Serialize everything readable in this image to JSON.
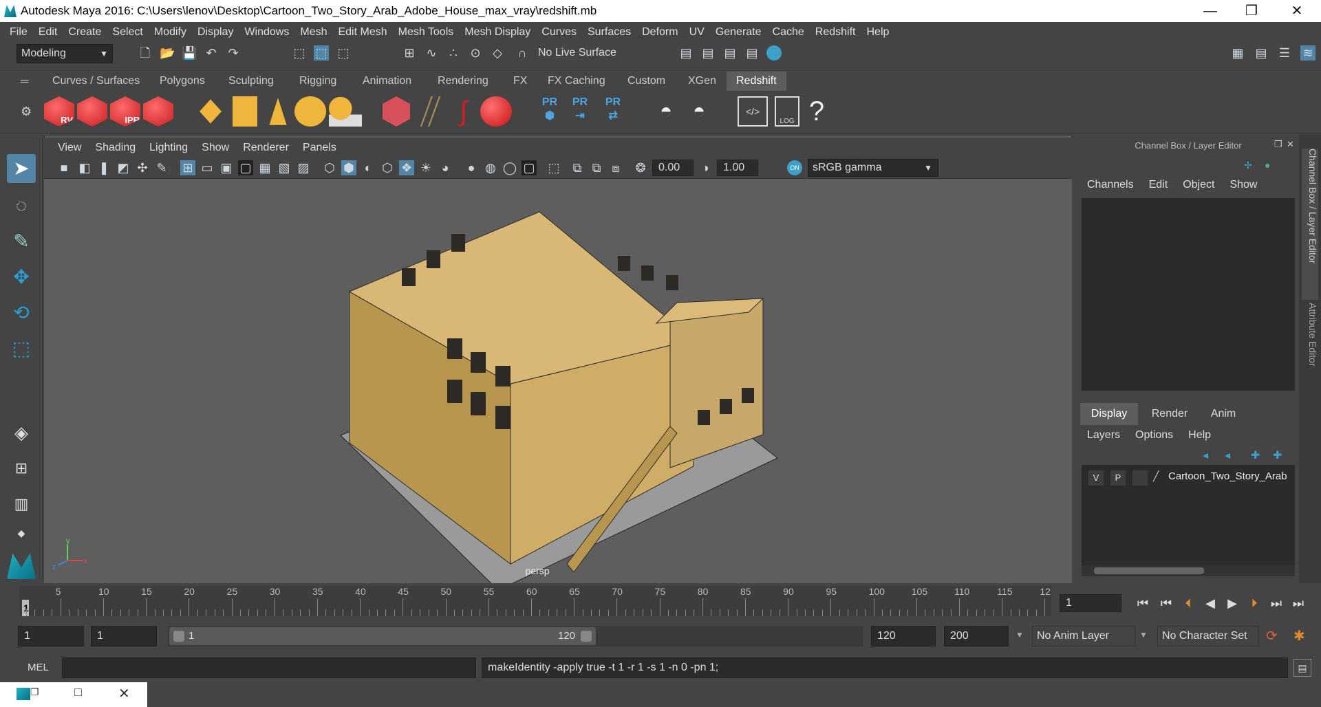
{
  "window": {
    "title": "Autodesk Maya 2016: C:\\Users\\lenov\\Desktop\\Cartoon_Two_Story_Arab_Adobe_House_max_vray\\redshift.mb",
    "minimize": "—",
    "maximize": "❐",
    "close": "✕"
  },
  "menubar": [
    "File",
    "Edit",
    "Create",
    "Select",
    "Modify",
    "Display",
    "Windows",
    "Mesh",
    "Edit Mesh",
    "Mesh Tools",
    "Mesh Display",
    "Curves",
    "Surfaces",
    "Deform",
    "UV",
    "Generate",
    "Cache",
    "Redshift",
    "Help"
  ],
  "statusline": {
    "mode": "Modeling",
    "live_surface": "No Live Surface"
  },
  "shelf_tabs": [
    "Curves / Surfaces",
    "Polygons",
    "Sculpting",
    "Rigging",
    "Animation",
    "Rendering",
    "FX",
    "FX Caching",
    "Custom",
    "XGen",
    "Redshift"
  ],
  "shelf_active": "Redshift",
  "shelf_icons": {
    "rv": "RV",
    "ipr": "IPR",
    "pr": "PR",
    "log": "LOG",
    "help": "?"
  },
  "viewport": {
    "menus": [
      "View",
      "Shading",
      "Lighting",
      "Show",
      "Renderer",
      "Panels"
    ],
    "exposure": "0.00",
    "gamma": "1.00",
    "color_space": "sRGB gamma",
    "camera_label": "persp",
    "axis": {
      "x": "x",
      "y": "y",
      "z": "z"
    }
  },
  "channel_box": {
    "title": "Channel Box / Layer Editor",
    "menus": [
      "Channels",
      "Edit",
      "Object",
      "Show"
    ],
    "tabs": [
      "Display",
      "Render",
      "Anim"
    ],
    "active_tab": "Display",
    "layer_menus": [
      "Layers",
      "Options",
      "Help"
    ],
    "layer": {
      "v": "V",
      "p": "P",
      "name": "Cartoon_Two_Story_Arab"
    }
  },
  "side_tabs": [
    "Channel Box / Layer Editor",
    "Attribute Editor"
  ],
  "timeline": {
    "ticks": [
      "5",
      "10",
      "15",
      "20",
      "25",
      "30",
      "35",
      "40",
      "45",
      "50",
      "55",
      "60",
      "65",
      "70",
      "75",
      "80",
      "85",
      "90",
      "95",
      "100",
      "105",
      "110",
      "115",
      "12"
    ],
    "first": "1",
    "current_frame": "1"
  },
  "range": {
    "start": "1",
    "playback_start": "1",
    "slider_start": "1",
    "slider_end": "120",
    "playback_end": "120",
    "end": "200",
    "anim_layer": "No Anim Layer",
    "character_set": "No Character Set"
  },
  "command": {
    "lang": "MEL",
    "result": "makeIdentity -apply true -t 1 -r 1 -s 1 -n 0 -pn 1;"
  },
  "colors": {
    "accent": "#5285a6",
    "redshift_red": "#d8282c",
    "mesh_tan": "#c8a868"
  }
}
